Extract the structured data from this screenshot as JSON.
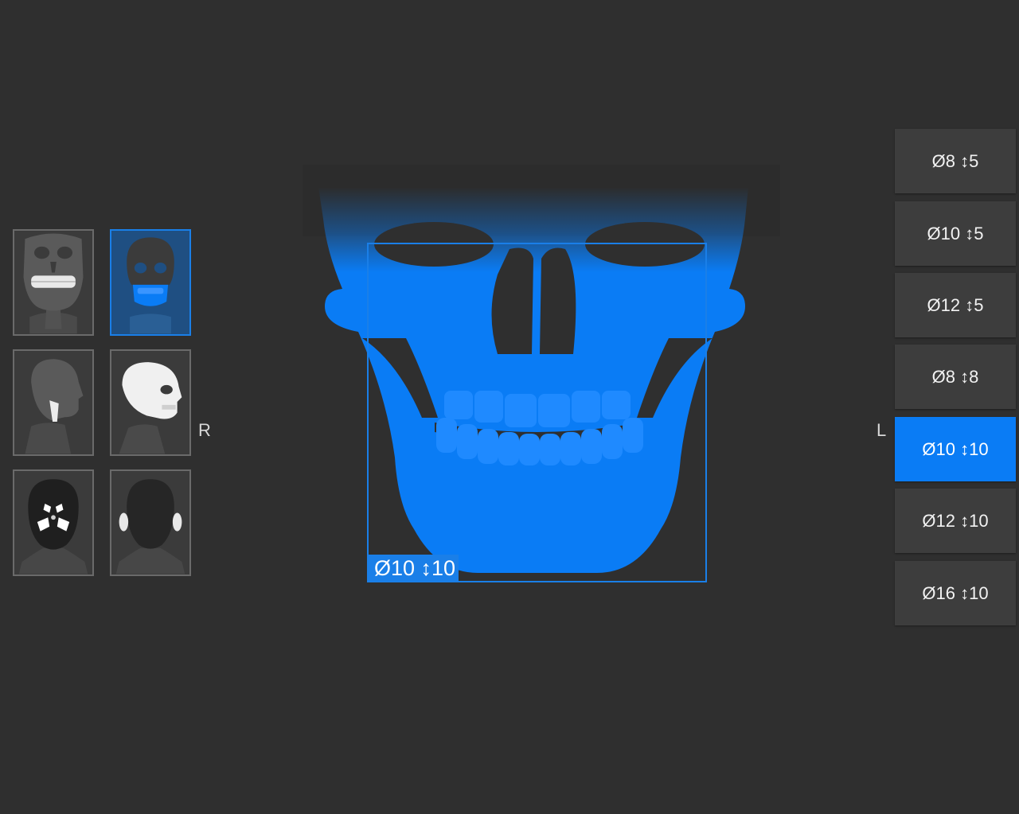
{
  "regions": {
    "thumbnails": [
      {
        "name": "full-dentition-frontal",
        "icon": "skull-teeth-frontal-icon"
      },
      {
        "name": "jaw-frontal",
        "icon": "skull-jaw-highlight-icon",
        "selected": true
      },
      {
        "name": "tmj-lateral",
        "icon": "head-tmj-lateral-icon"
      },
      {
        "name": "skull-lateral",
        "icon": "skull-lateral-icon"
      },
      {
        "name": "sinus-frontal",
        "icon": "head-sinus-icon"
      },
      {
        "name": "ears-frontal",
        "icon": "head-ears-icon"
      }
    ],
    "side_right_label": "R",
    "side_left_label": "L"
  },
  "fov_sizes": [
    {
      "label": "Ø8 ↕5",
      "active": false
    },
    {
      "label": "Ø10 ↕5",
      "active": false
    },
    {
      "label": "Ø12 ↕5",
      "active": false
    },
    {
      "label": "Ø8 ↕8",
      "active": false
    },
    {
      "label": "Ø10 ↕10",
      "active": true
    },
    {
      "label": "Ø12 ↕10",
      "active": false
    },
    {
      "label": "Ø16 ↕10",
      "active": false
    }
  ],
  "preview": {
    "fov_label": "Ø10 ↕10",
    "highlight_color": "#0a7cf5",
    "background_color": "#2f2f2f"
  }
}
